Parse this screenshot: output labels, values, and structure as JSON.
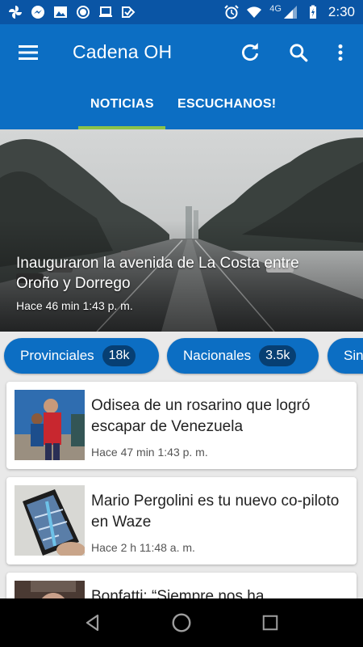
{
  "status_bar": {
    "time": "2:30",
    "network": "4G",
    "icons": [
      "pinwheel-icon",
      "messenger-icon",
      "image-icon",
      "circle-icon",
      "laptop-icon",
      "check-tag-icon"
    ],
    "right_icons": [
      "alarm-icon",
      "wifi-icon",
      "signal-icon",
      "battery-charging-icon"
    ]
  },
  "app_bar": {
    "title": "Cadena OH",
    "icons": [
      "menu-icon",
      "refresh-icon",
      "search-icon",
      "more-vert-icon"
    ],
    "color": "#0c6ec3"
  },
  "tabs": [
    {
      "label": "NOTICIAS",
      "active": true
    },
    {
      "label": "ESCUCHANOS!",
      "active": false
    }
  ],
  "hero": {
    "title": "Inauguraron la avenida de La Costa entre Oroño y Dorrego",
    "time": "Hace 46 min 1:43 p. m."
  },
  "categories": [
    {
      "label": "Provinciales",
      "count": "18k"
    },
    {
      "label": "Nacionales",
      "count": "3.5k"
    },
    {
      "label": "Sin",
      "count": ""
    }
  ],
  "articles": [
    {
      "title": "Odisea de un rosarino que logró escapar de Venezuela",
      "time": "Hace 47 min 1:43 p. m."
    },
    {
      "title": "Mario Pergolini es tu nuevo co-piloto en Waze",
      "time": "Hace 2 h 11:48 a. m."
    },
    {
      "title": "Bonfatti: “Siempre nos ha",
      "time": ""
    }
  ],
  "nav_bar": {
    "icons": [
      "back-icon",
      "home-icon",
      "recents-icon"
    ]
  },
  "accent_color": "#8bc34a"
}
